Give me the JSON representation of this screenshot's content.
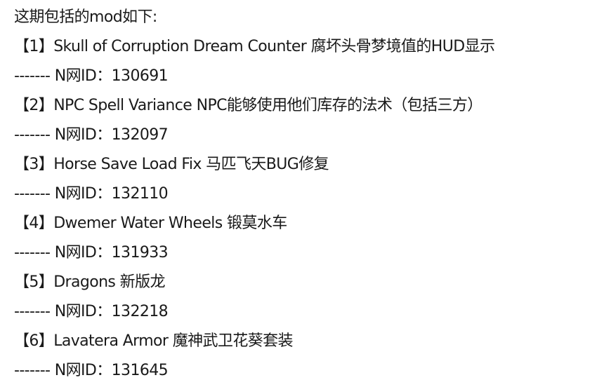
{
  "intro": "这期包括的mod如下:",
  "mods": [
    {
      "title": "【1】Skull of Corruption Dream Counter 腐坏头骨梦境值的HUD显示",
      "id_line": "------- N网ID：130691"
    },
    {
      "title": "【2】NPC Spell Variance NPC能够使用他们库存的法术（包括三方）",
      "id_line": "------- N网ID：132097"
    },
    {
      "title": "【3】Horse Save Load Fix 马匹飞天BUG修复",
      "id_line": "------- N网ID：132110"
    },
    {
      "title": "【4】Dwemer Water Wheels 锻莫水车",
      "id_line": "------- N网ID：131933"
    },
    {
      "title": "【5】Dragons 新版龙",
      "id_line": "------- N网ID：132218"
    },
    {
      "title": "【6】Lavatera Armor 魔神武卫花葵套装",
      "id_line": "------- N网ID：131645"
    }
  ]
}
